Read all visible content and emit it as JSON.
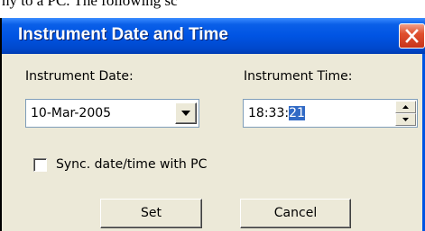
{
  "caption_fragment": "ny to a PC. The following sc",
  "dialog": {
    "title": "Instrument Date and Time",
    "close_icon": "close-icon"
  },
  "date": {
    "label": "Instrument Date:",
    "value": "10-Mar-2005",
    "dropdown_icon": "chevron-down-icon"
  },
  "time": {
    "label": "Instrument Time:",
    "hours_minutes": "18:33:",
    "seconds_selected": "21",
    "spin_up_icon": "arrow-up-icon",
    "spin_down_icon": "arrow-down-icon"
  },
  "sync": {
    "label": "Sync. date/time with PC",
    "checked": false
  },
  "buttons": {
    "set": "Set",
    "cancel": "Cancel"
  },
  "colors": {
    "titlebar": "#0054e3",
    "client": "#ece9d8",
    "selection": "#316ac5",
    "close": "#e0502e"
  }
}
